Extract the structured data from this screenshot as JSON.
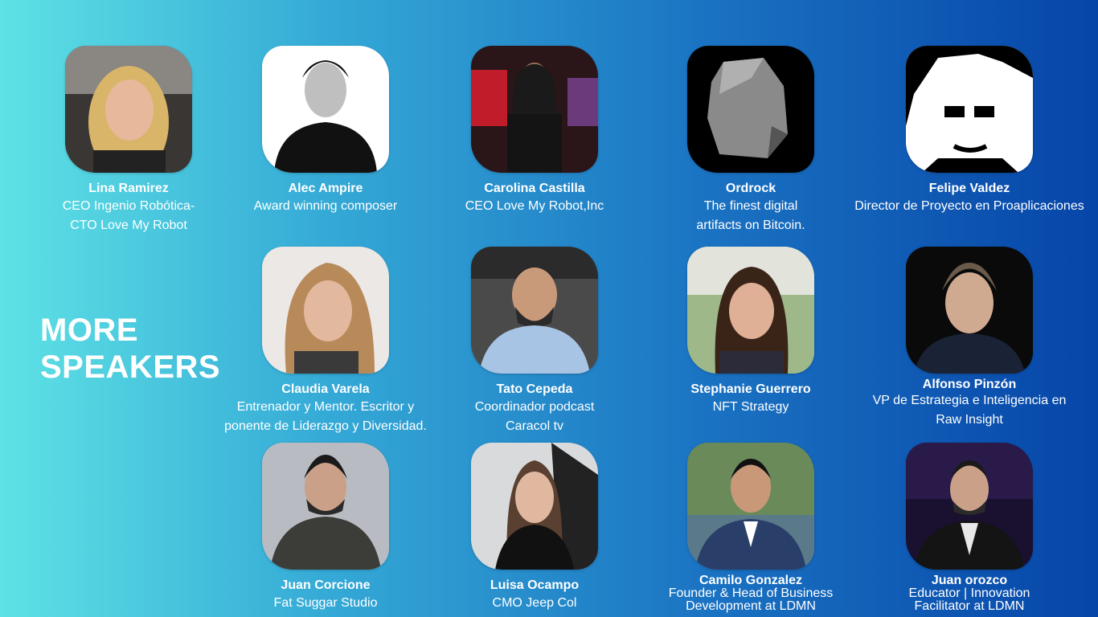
{
  "heading": {
    "line1": "MORE",
    "line2": "SPEAKERS"
  },
  "speakers": [
    {
      "name": "Lina Ramirez",
      "role": "CEO Ingenio Robótica-\nCTO Love My Robot"
    },
    {
      "name": "Alec Ampire",
      "role": "Award winning composer"
    },
    {
      "name": "Carolina Castilla",
      "role": "CEO Love My Robot,Inc"
    },
    {
      "name": "Ordrock",
      "role": "The finest digital\nartifacts on Bitcoin."
    },
    {
      "name": "Felipe Valdez",
      "role": "Director de Proyecto en Proaplicaciones"
    },
    {
      "name": "Claudia Varela",
      "role": "Entrenador y Mentor. Escritor y\nponente de Liderazgo y Diversidad."
    },
    {
      "name": "Tato Cepeda",
      "role": "Coordinador podcast\nCaracol tv"
    },
    {
      "name": "Stephanie Guerrero",
      "role": "NFT Strategy"
    },
    {
      "name": "Alfonso Pinzón",
      "role": "VP de Estrategia e Inteligencia en\nRaw Insight"
    },
    {
      "name": "Juan Corcione",
      "role": "Fat Suggar Studio"
    },
    {
      "name": "Luisa Ocampo",
      "role": "CMO Jeep Col"
    },
    {
      "name": "Camilo Gonzalez",
      "role": "Founder & Head of Business\nDevelopment at LDMN"
    },
    {
      "name": "Juan orozco",
      "role": "Educator | Innovation\nFacilitator at LDMN"
    }
  ]
}
